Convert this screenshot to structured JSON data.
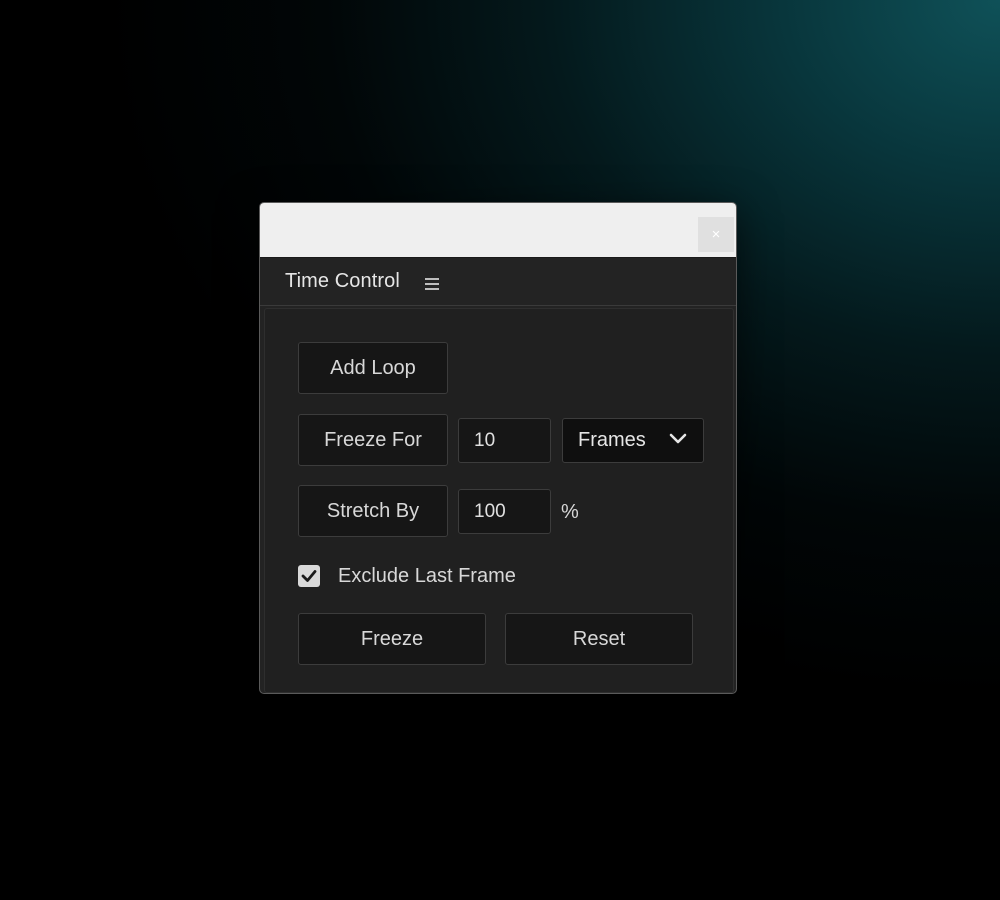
{
  "window": {
    "close_glyph": "×"
  },
  "panel": {
    "title": "Time Control",
    "menu_icon": "hamburger-menu-icon"
  },
  "controls": {
    "add_loop_label": "Add Loop",
    "freeze_for_label": "Freeze For",
    "freeze_for_value": "10",
    "unit_selected": "Frames",
    "stretch_by_label": "Stretch By",
    "stretch_by_value": "100",
    "percent_label": "%",
    "exclude_last_frame_label": "Exclude Last Frame",
    "exclude_last_frame_checked": true,
    "freeze_button_label": "Freeze",
    "reset_button_label": "Reset"
  },
  "colors": {
    "panel_bg": "#232323",
    "button_bg": "#161616",
    "titlebar_bg": "#efefef",
    "accent_teal": "#0f5158"
  }
}
